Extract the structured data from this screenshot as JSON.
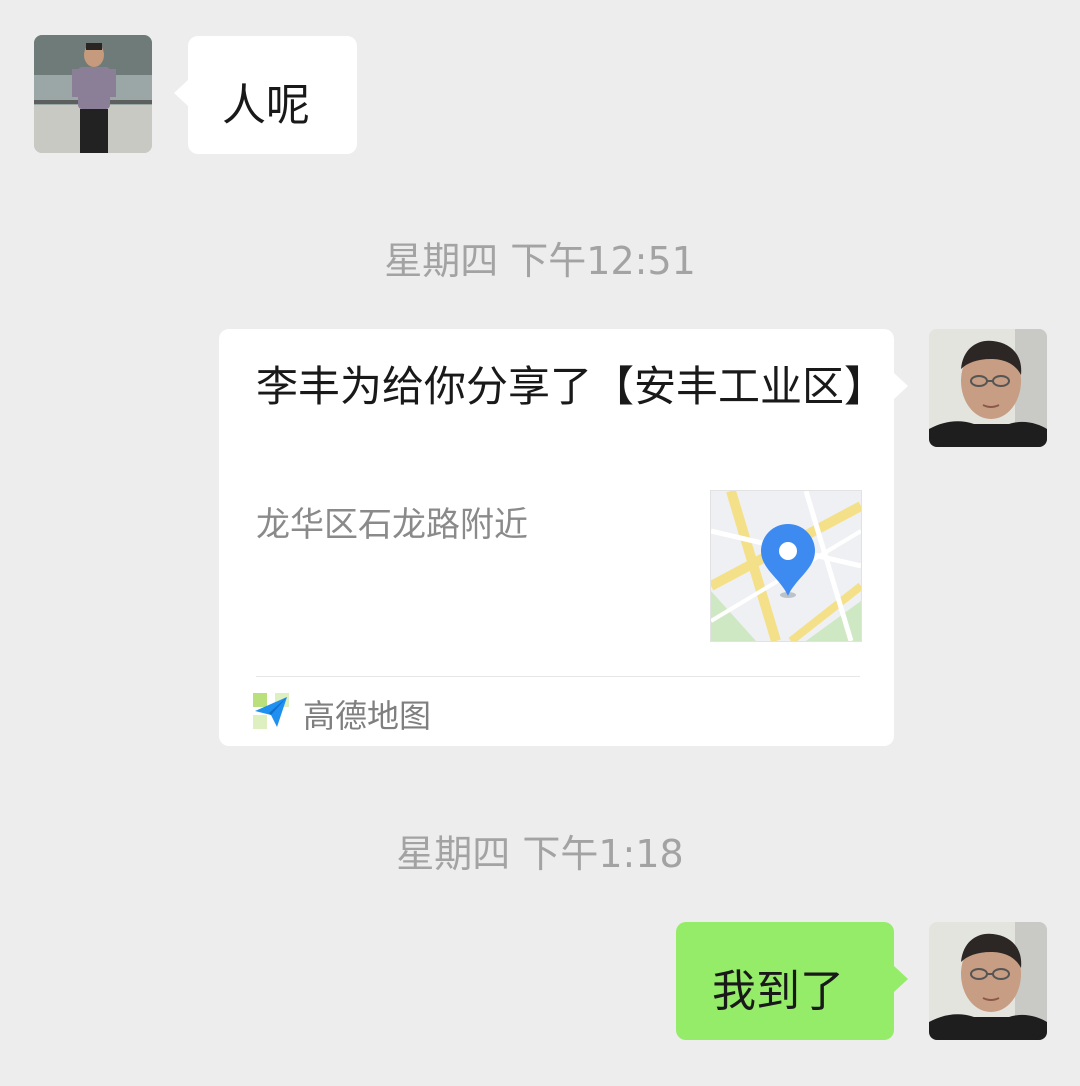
{
  "messages": [
    {
      "type": "text",
      "from": "contact",
      "text": "人呢"
    },
    {
      "type": "timestamp",
      "text": "星期四 下午12:51"
    },
    {
      "type": "location",
      "from": "me",
      "title": "李丰为给你分享了【安丰工业区】",
      "address": "龙华区石龙路附近",
      "source": "高德地图",
      "source_icon": "amap-logo-icon",
      "map_icon": "map-pin-icon"
    },
    {
      "type": "timestamp",
      "text": "星期四 下午1:18"
    },
    {
      "type": "text",
      "from": "me",
      "text": "我到了"
    }
  ],
  "colors": {
    "background": "#ededed",
    "bubble_incoming": "#ffffff",
    "bubble_outgoing": "#95ec69",
    "map_pin": "#3d8bf0"
  }
}
